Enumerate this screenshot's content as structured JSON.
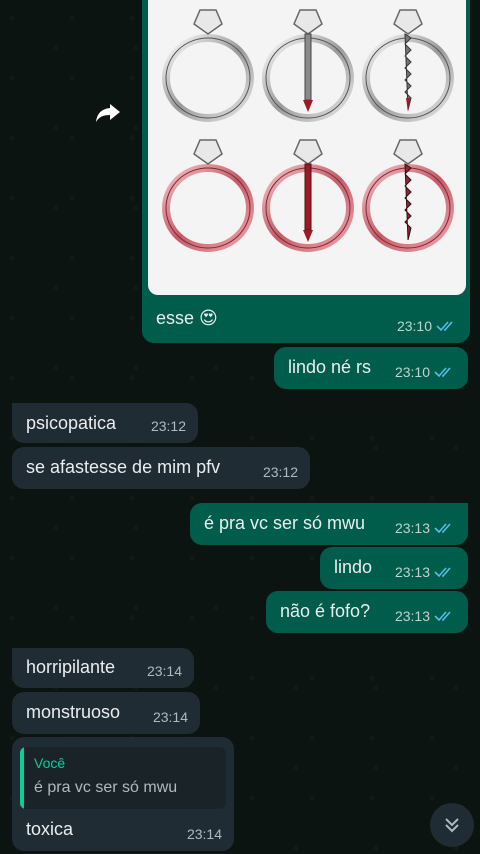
{
  "messages": [
    {
      "text": "esse 😍",
      "time": "23:10"
    },
    {
      "text": "lindo né rs",
      "time": "23:10"
    },
    {
      "text": "psicopatica",
      "time": "23:12"
    },
    {
      "text": "se afastesse de mim pfv",
      "time": "23:12"
    },
    {
      "text": "é pra vc ser só mwu",
      "time": "23:13"
    },
    {
      "text": "lindo",
      "time": "23:13"
    },
    {
      "text": "não é fofo?",
      "time": "23:13"
    },
    {
      "text": "horripilante",
      "time": "23:14"
    },
    {
      "text": "monstruoso",
      "time": "23:14"
    },
    {
      "text": "toxica",
      "time": "23:14",
      "quote_author": "Você",
      "quote_text": "é pra vc ser só mwu"
    }
  ],
  "colors": {
    "outgoing": "#005c4b",
    "incoming": "#202c33",
    "read_ticks": "#53bdeb",
    "quote_accent": "#06cf9c"
  },
  "icons": [
    "forward-arrow-icon",
    "double-check-icon",
    "chevron-down-icon"
  ]
}
